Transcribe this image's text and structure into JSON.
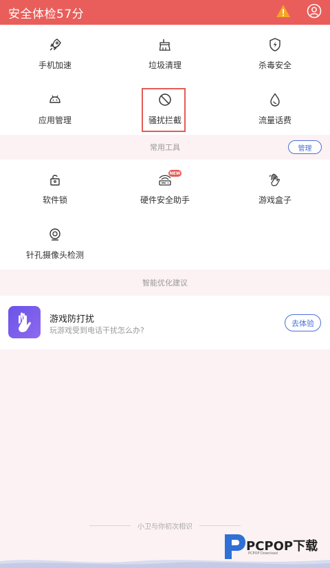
{
  "header": {
    "title": "安全体检57分",
    "icons": [
      "warning-icon",
      "user-icon"
    ],
    "colors": {
      "bar": "#e95e5a",
      "warning": "#f5a623"
    }
  },
  "main_grid": {
    "items": [
      {
        "label": "手机加速",
        "icon": "rocket-icon"
      },
      {
        "label": "垃圾清理",
        "icon": "broom-icon"
      },
      {
        "label": "杀毒安全",
        "icon": "shield-icon"
      },
      {
        "label": "应用管理",
        "icon": "android-icon"
      },
      {
        "label": "骚扰拦截",
        "icon": "block-icon"
      },
      {
        "label": "流量话费",
        "icon": "drop-icon"
      }
    ]
  },
  "tools_section": {
    "title": "常用工具",
    "manage_label": "管理",
    "badge": "NEW",
    "items": [
      {
        "label": "软件锁",
        "icon": "lock-icon"
      },
      {
        "label": "硬件安全助手",
        "icon": "router-icon"
      },
      {
        "label": "游戏盒子",
        "icon": "hand-icon"
      },
      {
        "label": "针孔摄像头检测",
        "icon": "camera-icon"
      }
    ]
  },
  "suggest_section": {
    "title": "智能优化建议",
    "card": {
      "title": "游戏防打扰",
      "subtitle": "玩游戏受到电话干扰怎么办?",
      "button": "去体验",
      "icon": "hand-icon"
    }
  },
  "footer": {
    "text": "小卫与你初次相识",
    "watermark_main": "PCPOP下载",
    "watermark_sub": "PCPOP Download"
  }
}
